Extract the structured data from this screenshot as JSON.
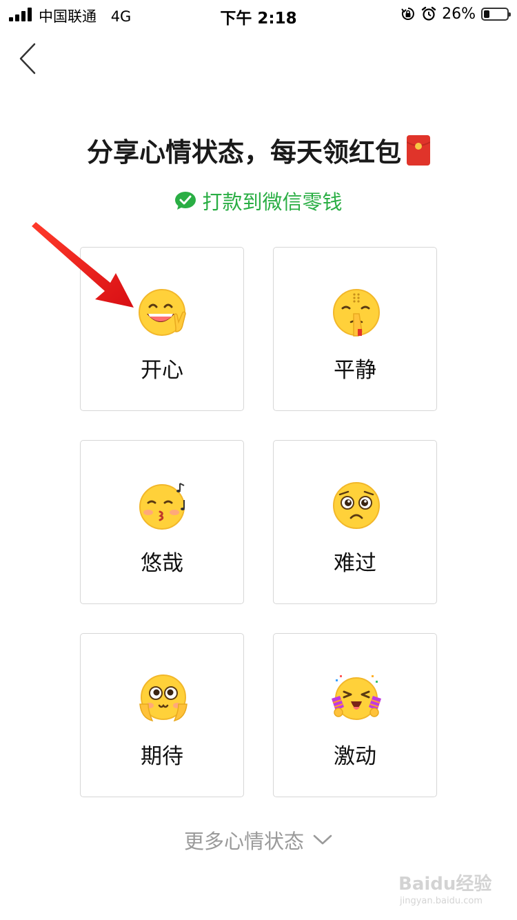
{
  "status_bar": {
    "carrier": "中国联通",
    "network": "4G",
    "time": "下午 2:18",
    "battery_percent_text": "26%",
    "battery_level": 0.26
  },
  "header": {
    "title": "分享心情状态，每天领红包",
    "subtitle": "打款到微信零钱"
  },
  "moods": [
    {
      "label": "开心",
      "icon": "happy-victory-emoji"
    },
    {
      "label": "平静",
      "icon": "calm-praying-emoji"
    },
    {
      "label": "悠哉",
      "icon": "whistling-emoji"
    },
    {
      "label": "难过",
      "icon": "sad-pleading-emoji"
    },
    {
      "label": "期待",
      "icon": "expectant-emoji"
    },
    {
      "label": "激动",
      "icon": "excited-emoji"
    }
  ],
  "more": {
    "label": "更多心情状态"
  },
  "colors": {
    "accent_green": "#2aae44",
    "emoji_yellow": "#ffd13a",
    "annotation_red": "#e8141c",
    "card_border": "#d6d6d6",
    "muted_text": "#9a9a9a"
  },
  "watermark": {
    "text": "Baidu经验",
    "url_text": "jingyan.baidu.com"
  }
}
